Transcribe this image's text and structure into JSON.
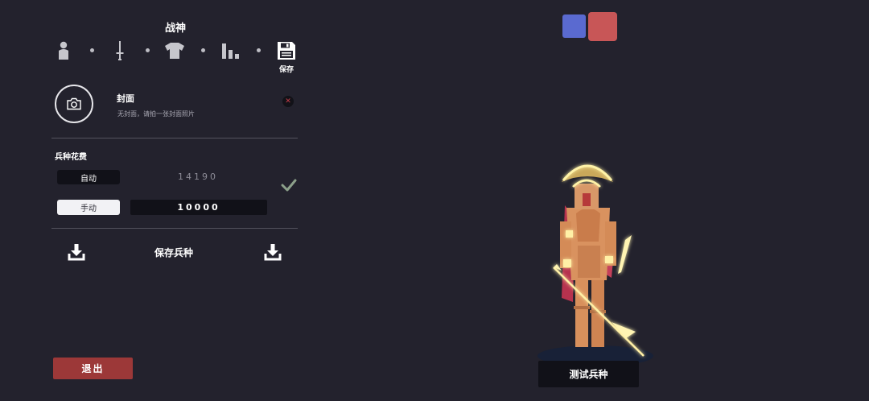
{
  "header": {
    "title": "战神"
  },
  "tabs": [
    {
      "icon": "person-icon"
    },
    {
      "icon": "sword-icon"
    },
    {
      "icon": "shirt-icon"
    },
    {
      "icon": "stats-bars-icon"
    },
    {
      "icon": "save-disk-icon",
      "label": "保存"
    }
  ],
  "cover": {
    "icon": "camera-icon",
    "title": "封面",
    "subtitle": "无封面，请拍一张封面照片",
    "clear_icon": "close-icon"
  },
  "cost": {
    "title": "兵种花费",
    "auto_label": "自动",
    "auto_value": "14190",
    "manual_label": "手动",
    "manual_value": "10000",
    "confirm_icon": "check-icon"
  },
  "save_unit": {
    "label": "保存兵种",
    "left_icon": "download-icon",
    "right_icon": "download-icon"
  },
  "exit_label": "退出",
  "team_colors": {
    "blue": "#5a6ad0",
    "red": "#c85657"
  },
  "test_label": "测试兵种",
  "colors": {
    "background": "#23222d",
    "exit": "#9c3838",
    "panel_dark": "#111118"
  }
}
